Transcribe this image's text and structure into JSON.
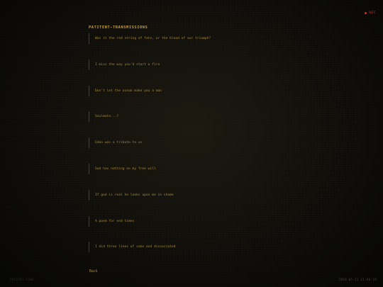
{
  "status": {
    "rec_label": "REC",
    "rec_color": "#c23a26"
  },
  "header": {
    "title": "PATITENT-TRANSMISSIONS"
  },
  "transmissions": [
    {
      "label": "Was it the red string of fate, or the blood of our triumph?"
    },
    {
      "label": "I miss the way you'd start a fire"
    },
    {
      "label": "Don't let the ocean make you a man"
    },
    {
      "label": "Soulmate...?"
    },
    {
      "label": "Eden was a tribute to us"
    },
    {
      "label": "God has nothing on my free will"
    },
    {
      "label": "If god is real he looks upon me in shame"
    },
    {
      "label": "A poem for end times"
    },
    {
      "label": "I did three lines of coke and dissociated"
    }
  ],
  "nav": {
    "back_label": "Back"
  },
  "footer": {
    "left_text": "PATIENT-LINK",
    "timestamp": "2026-05-11 21:06:19"
  },
  "colors": {
    "accent": "#c9a03e",
    "text": "#a8883a",
    "background": "#0d0c08"
  }
}
